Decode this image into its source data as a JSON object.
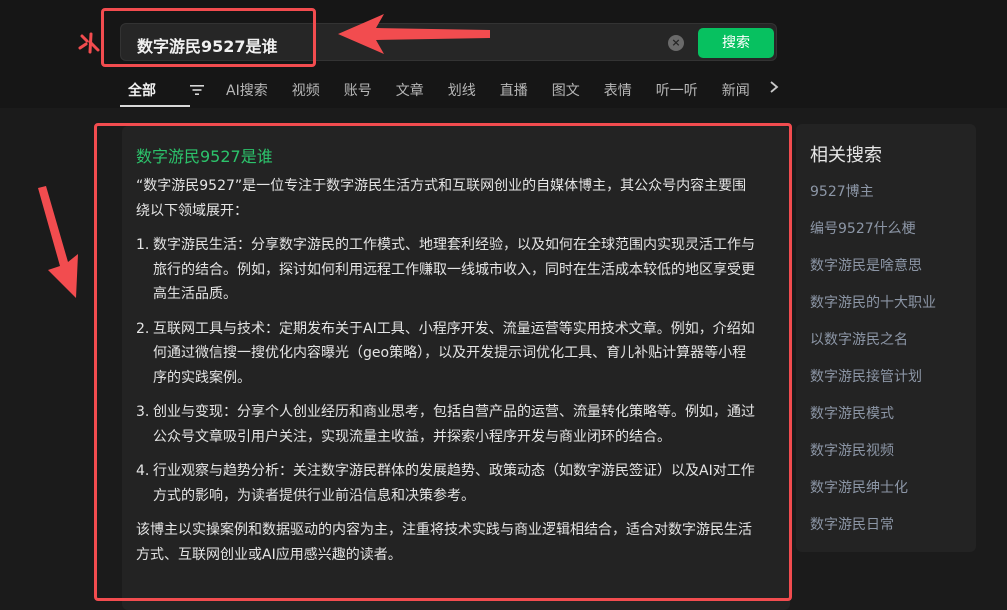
{
  "search": {
    "query": "数字游民9527是谁",
    "button_label": "搜索"
  },
  "tabs": [
    {
      "label": "全部",
      "active": true
    },
    {
      "label": "AI搜索"
    },
    {
      "label": "视频"
    },
    {
      "label": "账号"
    },
    {
      "label": "文章"
    },
    {
      "label": "划线"
    },
    {
      "label": "直播"
    },
    {
      "label": "图文"
    },
    {
      "label": "表情"
    },
    {
      "label": "听一听"
    },
    {
      "label": "新闻"
    }
  ],
  "answer": {
    "title": "数字游民9527是谁",
    "intro": "“数字游民9527”是一位专注于数字游民生活方式和互联网创业的自媒体博主，其公众号内容主要围绕以下领域展开：",
    "points": [
      {
        "num": "1.",
        "text": "数字游民生活：分享数字游民的工作模式、地理套利经验，以及如何在全球范围内实现灵活工作与旅行的结合。例如，探讨如何利用远程工作赚取一线城市收入，同时在生活成本较低的地区享受更高生活品质。"
      },
      {
        "num": "2.",
        "text": "互联网工具与技术：定期发布关于AI工具、小程序开发、流量运营等实用技术文章。例如，介绍如何通过微信搜一搜优化内容曝光（geo策略），以及开发提示词优化工具、育儿补贴计算器等小程序的实践案例。"
      },
      {
        "num": "3.",
        "text": "创业与变现：分享个人创业经历和商业思考，包括自营产品的运营、流量转化策略等。例如，通过公众号文章吸引用户关注，实现流量主收益，并探索小程序开发与商业闭环的结合。"
      },
      {
        "num": "4.",
        "text": "行业观察与趋势分析：关注数字游民群体的发展趋势、政策动态（如数字游民签证）以及AI对工作方式的影响，为读者提供行业前沿信息和决策参考。"
      }
    ],
    "summary": "该博主以实操案例和数据驱动的内容为主，注重将技术实践与商业逻辑相结合，适合对数字游民生活方式、互联网创业或AI应用感兴趣的读者。"
  },
  "related": {
    "title": "相关搜索",
    "items": [
      "9527博主",
      "编号9527什么梗",
      "数字游民是啥意思",
      "数字游民的十大职业",
      "以数字游民之名",
      "数字游民接管计划",
      "数字游民模式",
      "数字游民视频",
      "数字游民绅士化",
      "数字游民日常"
    ]
  },
  "colors": {
    "accent_green": "#07c160",
    "title_green": "#2cc36b",
    "annotation_red": "#f24c4f",
    "related_link": "#8c96a6"
  }
}
